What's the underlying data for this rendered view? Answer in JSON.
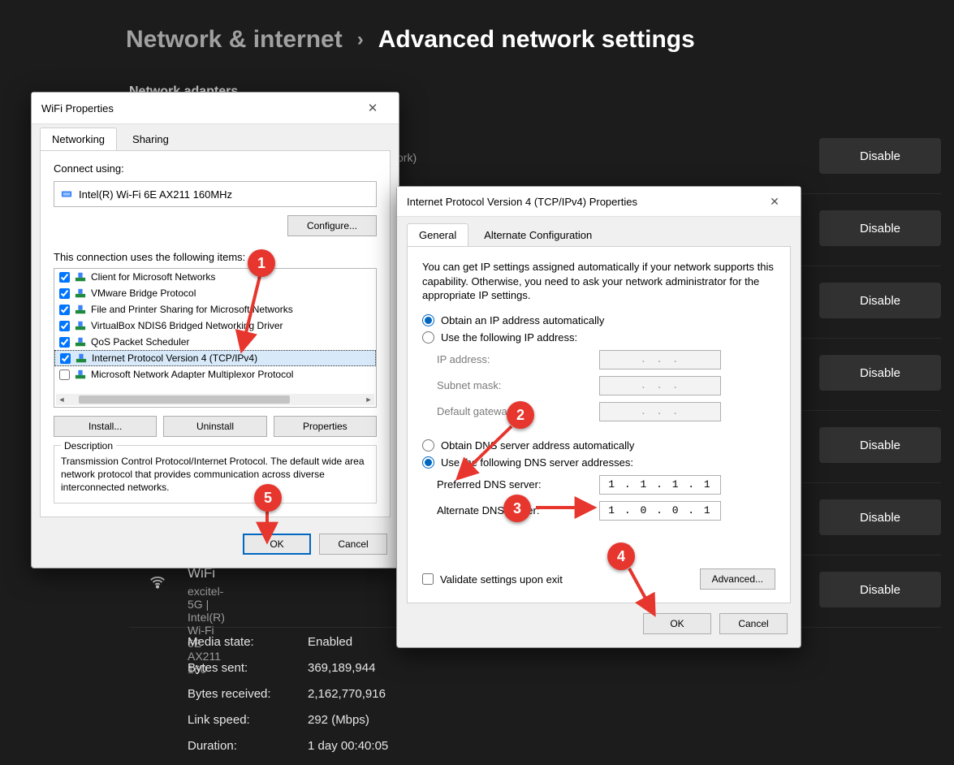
{
  "breadcrumb": {
    "root": "Network & internet",
    "current": "Advanced network settings"
  },
  "section_heading": "Network adapters",
  "disable_label": "Disable",
  "wifi_block": {
    "title": "WiFi",
    "subtitle": "excitel-5G | Intel(R) Wi-Fi 6E AX211 160"
  },
  "stats": [
    {
      "k": "Media state:",
      "v": "Enabled"
    },
    {
      "k": "Bytes sent:",
      "v": "369,189,944"
    },
    {
      "k": "Bytes received:",
      "v": "2,162,770,916"
    },
    {
      "k": "Link speed:",
      "v": "292 (Mbps)"
    },
    {
      "k": "Duration:",
      "v": "1 day 00:40:05"
    }
  ],
  "dlg1": {
    "title": "WiFi Properties",
    "tabs": {
      "networking": "Networking",
      "sharing": "Sharing"
    },
    "connect_using_label": "Connect using:",
    "adapter_name": "Intel(R) Wi-Fi 6E AX211 160MHz",
    "configure_btn": "Configure...",
    "items_label": "This connection uses the following items:",
    "items": [
      {
        "checked": true,
        "label": "Client for Microsoft Networks"
      },
      {
        "checked": true,
        "label": "VMware Bridge Protocol"
      },
      {
        "checked": true,
        "label": "File and Printer Sharing for Microsoft Networks"
      },
      {
        "checked": true,
        "label": "VirtualBox NDIS6 Bridged Networking Driver"
      },
      {
        "checked": true,
        "label": "QoS Packet Scheduler"
      },
      {
        "checked": true,
        "label": "Internet Protocol Version 4 (TCP/IPv4)",
        "selected": true
      },
      {
        "checked": false,
        "label": "Microsoft Network Adapter Multiplexor Protocol"
      }
    ],
    "install_btn": "Install...",
    "uninstall_btn": "Uninstall",
    "properties_btn": "Properties",
    "desc_legend": "Description",
    "desc_text": "Transmission Control Protocol/Internet Protocol. The default wide area network protocol that provides communication across diverse interconnected networks.",
    "ok_btn": "OK",
    "cancel_btn": "Cancel"
  },
  "dlg2": {
    "title": "Internet Protocol Version 4 (TCP/IPv4) Properties",
    "tabs": {
      "general": "General",
      "alt": "Alternate Configuration"
    },
    "intro": "You can get IP settings assigned automatically if your network supports this capability. Otherwise, you need to ask your network administrator for the appropriate IP settings.",
    "ip_auto": "Obtain an IP address automatically",
    "ip_manual": "Use the following IP address:",
    "ip_fields": {
      "ip": "IP address:",
      "mask": "Subnet mask:",
      "gw": "Default gateway:"
    },
    "dns_auto": "Obtain DNS server address automatically",
    "dns_manual": "Use the following DNS server addresses:",
    "dns_fields": {
      "pref_label": "Preferred DNS server:",
      "pref_value": "1 . 1 . 1 . 1",
      "alt_label": "Alternate DNS server:",
      "alt_value": "1 . 0 . 0 . 1"
    },
    "validate": "Validate settings upon exit",
    "advanced_btn": "Advanced...",
    "ok_btn": "OK",
    "cancel_btn": "Cancel"
  },
  "callouts": {
    "c1": "1",
    "c2": "2",
    "c3": "3",
    "c4": "4",
    "c5": "5"
  },
  "ip_placeholder": ".       .       ."
}
